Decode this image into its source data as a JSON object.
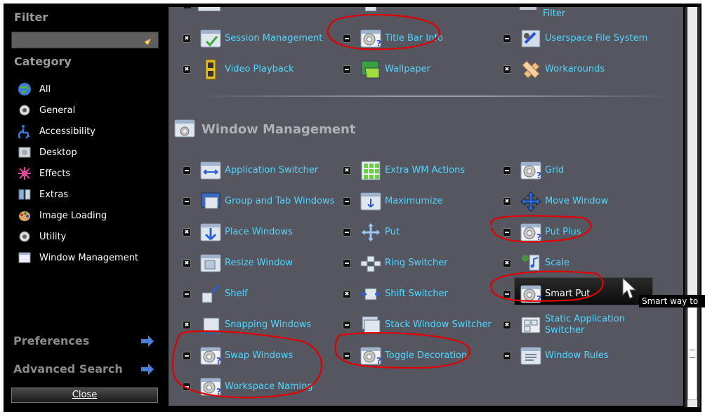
{
  "sidebar": {
    "filter_title": "Filter",
    "filter_value": "",
    "category_title": "Category",
    "categories": [
      "All",
      "General",
      "Accessibility",
      "Desktop",
      "Effects",
      "Extras",
      "Image Loading",
      "Utility",
      "Window Management"
    ],
    "preferences": "Preferences",
    "advanced_search": "Advanced Search",
    "close": "Close"
  },
  "top_section": {
    "partial_items": [
      "Filter"
    ],
    "rows": [
      [
        {
          "label": "Session Management",
          "enabled": true,
          "icon": "session-icon"
        },
        {
          "label": "Title Bar Info",
          "enabled": false,
          "icon": "gear-question-icon"
        },
        {
          "label": "Userspace File System",
          "enabled": false,
          "icon": "filesystem-icon"
        }
      ],
      [
        {
          "label": "Video Playback",
          "enabled": true,
          "icon": "film-icon"
        },
        {
          "label": "Wallpaper",
          "enabled": false,
          "icon": "wallpaper-icon"
        },
        {
          "label": "Workarounds",
          "enabled": true,
          "icon": "bandage-icon"
        }
      ]
    ]
  },
  "wm_section": {
    "title": "Window Management",
    "rows": [
      [
        {
          "label": "Application Switcher",
          "enabled": false,
          "icon": "app-switcher-icon"
        },
        {
          "label": "Extra WM Actions",
          "enabled": true,
          "icon": "grid-icon"
        },
        {
          "label": "Grid",
          "enabled": false,
          "icon": "gear-question-icon"
        }
      ],
      [
        {
          "label": "Group and Tab Windows",
          "enabled": false,
          "icon": "group-tab-icon"
        },
        {
          "label": "Maximumize",
          "enabled": false,
          "icon": "maximize-icon"
        },
        {
          "label": "Move Window",
          "enabled": true,
          "icon": "move-icon"
        }
      ],
      [
        {
          "label": "Place Windows",
          "enabled": true,
          "icon": "place-icon"
        },
        {
          "label": "Put",
          "enabled": false,
          "icon": "put-icon"
        },
        {
          "label": "Put Plus",
          "enabled": false,
          "icon": "gear-question-icon"
        }
      ],
      [
        {
          "label": "Resize Window",
          "enabled": true,
          "icon": "resize-icon"
        },
        {
          "label": "Ring Switcher",
          "enabled": false,
          "icon": "ring-icon"
        },
        {
          "label": "Scale",
          "enabled": true,
          "icon": "scale-icon"
        }
      ],
      [
        {
          "label": "Shelf",
          "enabled": false,
          "icon": "shelf-icon"
        },
        {
          "label": "Shift Switcher",
          "enabled": true,
          "icon": "shift-icon"
        },
        {
          "label": "Smart Put",
          "enabled": false,
          "icon": "gear-question-icon"
        }
      ],
      [
        {
          "label": "Snapping Windows",
          "enabled": true,
          "icon": "snap-icon"
        },
        {
          "label": "Stack Window Switcher",
          "enabled": false,
          "icon": "stack-icon"
        },
        {
          "label": "Static Application Switcher",
          "enabled": true,
          "icon": "static-switcher-icon"
        }
      ],
      [
        {
          "label": "Swap Windows",
          "enabled": false,
          "icon": "gear-question-icon"
        },
        {
          "label": "Toggle Decoration",
          "enabled": false,
          "icon": "gear-question-icon"
        },
        {
          "label": "Window Rules",
          "enabled": false,
          "icon": "window-rules-icon"
        }
      ],
      [
        {
          "label": "Workspace Naming",
          "enabled": false,
          "icon": "gear-question-icon"
        }
      ]
    ]
  },
  "tooltip": "Smart way to",
  "colors": {
    "link": "#4fd6ff",
    "panel": "#565660",
    "annotation": "#e00000"
  }
}
